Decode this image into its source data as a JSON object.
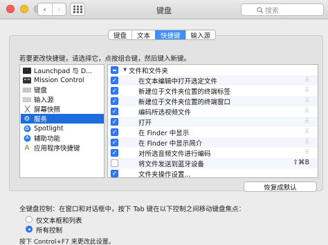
{
  "window": {
    "title": "键盘"
  },
  "search": {
    "placeholder": "搜索"
  },
  "tabs": [
    {
      "label": "键盘",
      "active": false
    },
    {
      "label": "文本",
      "active": false
    },
    {
      "label": "快捷键",
      "active": true
    },
    {
      "label": "输入源",
      "active": false
    }
  ],
  "instruction": "若要更改快捷键，请选择它，点按组合键，然后键入新键。",
  "categories": [
    {
      "label": "Launchpad 与 D...",
      "icon": "launchpad-icon"
    },
    {
      "label": "Mission Control",
      "icon": "mission-control-icon"
    },
    {
      "label": "键盘",
      "icon": "keyboard-icon"
    },
    {
      "label": "输入源",
      "icon": "input-source-icon"
    },
    {
      "label": "屏幕快照",
      "icon": "screenshot-icon"
    },
    {
      "label": "服务",
      "icon": "services-gear-icon",
      "selected": true
    },
    {
      "label": "Spotlight",
      "icon": "spotlight-icon"
    },
    {
      "label": "辅助功能",
      "icon": "accessibility-icon"
    },
    {
      "label": "应用程序快捷键",
      "icon": "app-shortcuts-icon"
    }
  ],
  "shortcuts": {
    "group_label": "文件和文件夹",
    "items": [
      {
        "label": "在文本编辑中打开选定文件",
        "checked": true,
        "key": "无"
      },
      {
        "label": "新建位于文件夹位置的终端标签",
        "checked": true,
        "key": "无"
      },
      {
        "label": "新建位于文件夹位置的终端窗口",
        "checked": true,
        "key": "无"
      },
      {
        "label": "编码所选视频文件",
        "checked": true,
        "key": "无"
      },
      {
        "label": "打开",
        "checked": true,
        "key": "无"
      },
      {
        "label": "在 Finder 中显示",
        "checked": true,
        "key": "无"
      },
      {
        "label": "在 Finder 中显示简介",
        "checked": true,
        "key": "无"
      },
      {
        "label": "对所选音频文件进行编码",
        "checked": true,
        "key": "无"
      },
      {
        "label": "将文件发送到蓝牙设备",
        "checked": false,
        "key": "⇧⌘B"
      },
      {
        "label": "文件夹操作设置...",
        "checked": true,
        "key": ""
      }
    ]
  },
  "restore_label": "恢复成默认",
  "full_keyboard_control": {
    "label": "全键盘控制：在窗口和对话框中，按下 Tab 键在以下控制之间移动键盘焦点：",
    "options": [
      {
        "label": "仅文本框和列表",
        "selected": false
      },
      {
        "label": "所有控制",
        "selected": true
      }
    ],
    "hint": "按下 Control+F7 来更改此设置。"
  },
  "colors": {
    "accent": "#3478f6",
    "selection": "#1d6edc"
  }
}
